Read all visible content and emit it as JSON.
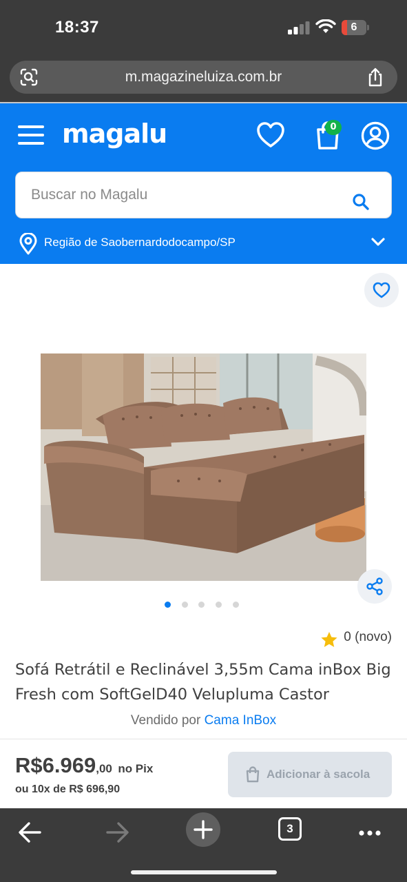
{
  "status_bar": {
    "time": "18:37",
    "battery_level": "6"
  },
  "browser": {
    "url": "m.magazineluiza.com.br",
    "tab_count": "3"
  },
  "header": {
    "logo": "magalu",
    "cart_count": "0",
    "brand_color": "#0a7cf0",
    "search_placeholder": "Buscar no Magalu",
    "region": "Região de Saobernardodocampo/SP"
  },
  "product": {
    "title": "Sofá Retrátil e Reclinável 3,55m Cama inBox Big Fresh com SoftGelD40 Velupluma Castor",
    "rating": "0 (novo)",
    "seller_prefix": "Vendido por",
    "seller_name": "Cama InBox",
    "gallery_total": 5,
    "gallery_active": 0
  },
  "buy_bar": {
    "price_int": "R$6.969",
    "price_cents": ",00",
    "price_suffix": "no Pix",
    "installments": "ou 10x de R$ 696,90",
    "add_button": "Adicionar à sacola"
  }
}
